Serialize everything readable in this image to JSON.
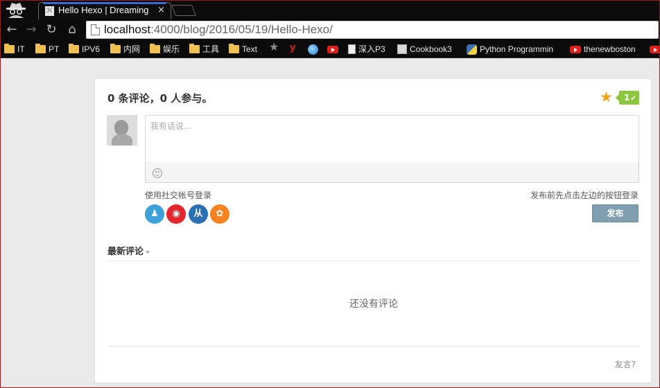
{
  "browser": {
    "tab_title": "Hello Hexo | Dreaming",
    "tab_close": "×",
    "favicon_text": "ℋ",
    "url_host": "localhost",
    "url_rest": ":4000/blog/2016/05/19/Hello-Hexo/",
    "nav": {
      "back": "←",
      "forward": "→",
      "reload": "↻",
      "home": "⌂"
    }
  },
  "bookmarks": [
    {
      "label": "IT",
      "icon": "folder-icon"
    },
    {
      "label": "PT",
      "icon": "folder-icon"
    },
    {
      "label": "IPV6",
      "icon": "folder-icon"
    },
    {
      "label": "内网",
      "icon": "folder-icon"
    },
    {
      "label": "娱乐",
      "icon": "folder-icon"
    },
    {
      "label": "工具",
      "icon": "folder-icon"
    },
    {
      "label": "Text",
      "icon": "folder-icon"
    },
    {
      "label": "",
      "icon": "star-bookmark-icon"
    },
    {
      "label": "",
      "icon": "y-bookmark-icon",
      "glyph": "y"
    },
    {
      "label": "",
      "icon": "globe-icon"
    },
    {
      "label": "",
      "icon": "youtube-icon"
    },
    {
      "label": "深入P3",
      "icon": "document-icon"
    },
    {
      "label": "Cookbook3",
      "icon": "book-icon"
    },
    {
      "label": "Python Programmin",
      "icon": "python-icon"
    },
    {
      "label": "thenewboston",
      "icon": "youtube-icon"
    },
    {
      "label": "",
      "icon": "youtube-icon"
    }
  ],
  "comments": {
    "count_title": "0 条评论，0 人参与。",
    "like_count": "1",
    "like_check": "✔",
    "star_glyph": "★",
    "editor_placeholder": "我有话说...",
    "social_login_label": "使用社交帐号登录",
    "login_hint": "发布前先点击左边的按钮登录",
    "publish_label": "发布",
    "latest_label": "最新评论",
    "empty_text": "还没有评论",
    "footer_link": "友言?",
    "social_icons": [
      {
        "name": "qq-login-icon",
        "color": "#3ea0d8",
        "glyph": "♟"
      },
      {
        "name": "weibo-login-icon",
        "color": "#e3262e",
        "glyph": "◉"
      },
      {
        "name": "renren-login-icon",
        "color": "#2d6fb3",
        "glyph": "从"
      },
      {
        "name": "douban-login-icon",
        "color": "#f5831f",
        "glyph": "✿"
      }
    ]
  },
  "colors": {
    "chrome_bg": "#0b0b0b",
    "page_bg": "#eaeaea",
    "publish_button": "#7f9fb0",
    "like_badge": "#8dc63f",
    "star": "#f0a21a",
    "tab_accent": "#3b6bd6"
  }
}
